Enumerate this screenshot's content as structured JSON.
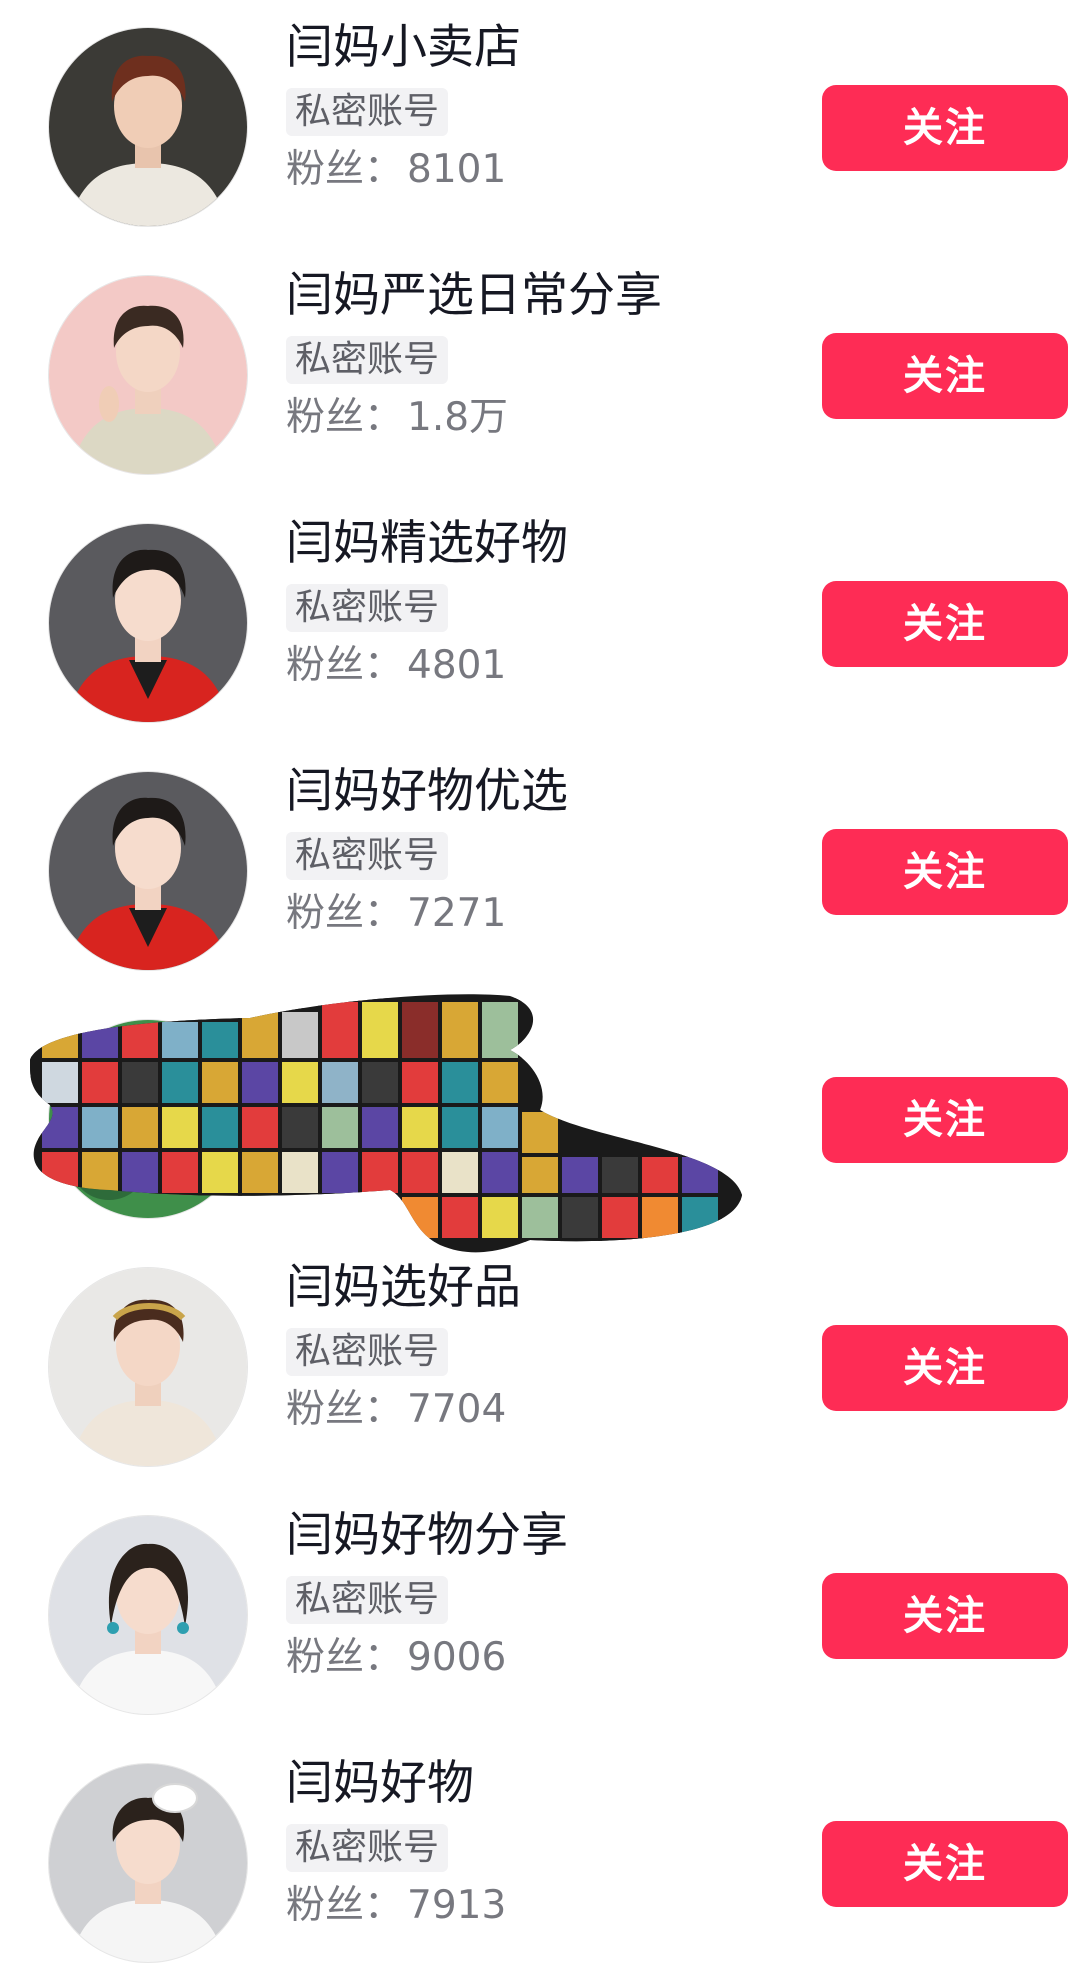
{
  "colors": {
    "follow_bg": "#fe2c55",
    "follow_text": "#ffffff",
    "name_text": "#161823",
    "tag_bg": "#f2f2f4",
    "fans_text": "#77787f"
  },
  "accounts": [
    {
      "name": "闫妈小卖店",
      "tag": "私密账号",
      "fans_label": "粉丝：",
      "fans_value": "8101",
      "follow_label": "关注",
      "avatar_icon": "woman-portrait-avatar-icon"
    },
    {
      "name": "闫妈严选日常分享",
      "tag": "私密账号",
      "fans_label": "粉丝：",
      "fans_value": "1.8万",
      "follow_label": "关注",
      "avatar_icon": "woman-portrait-avatar-icon"
    },
    {
      "name": "闫妈精选好物",
      "tag": "私密账号",
      "fans_label": "粉丝：",
      "fans_value": "4801",
      "follow_label": "关注",
      "avatar_icon": "woman-portrait-avatar-icon"
    },
    {
      "name": "闫妈好物优选",
      "tag": "私密账号",
      "fans_label": "粉丝：",
      "fans_value": "7271",
      "follow_label": "关注",
      "avatar_icon": "woman-portrait-avatar-icon"
    },
    {
      "name": "",
      "tag": "",
      "fans_label": "",
      "fans_value": "",
      "follow_label": "关注",
      "avatar_icon": "redacted-mosaic-icon"
    },
    {
      "name": "闫妈选好品",
      "tag": "私密账号",
      "fans_label": "粉丝：",
      "fans_value": "7704",
      "follow_label": "关注",
      "avatar_icon": "woman-portrait-avatar-icon"
    },
    {
      "name": "闫妈好物分享",
      "tag": "私密账号",
      "fans_label": "粉丝：",
      "fans_value": "9006",
      "follow_label": "关注",
      "avatar_icon": "woman-portrait-avatar-icon"
    },
    {
      "name": "闫妈好物",
      "tag": "私密账号",
      "fans_label": "粉丝：",
      "fans_value": "7913",
      "follow_label": "关注",
      "avatar_icon": "woman-portrait-avatar-icon"
    }
  ]
}
